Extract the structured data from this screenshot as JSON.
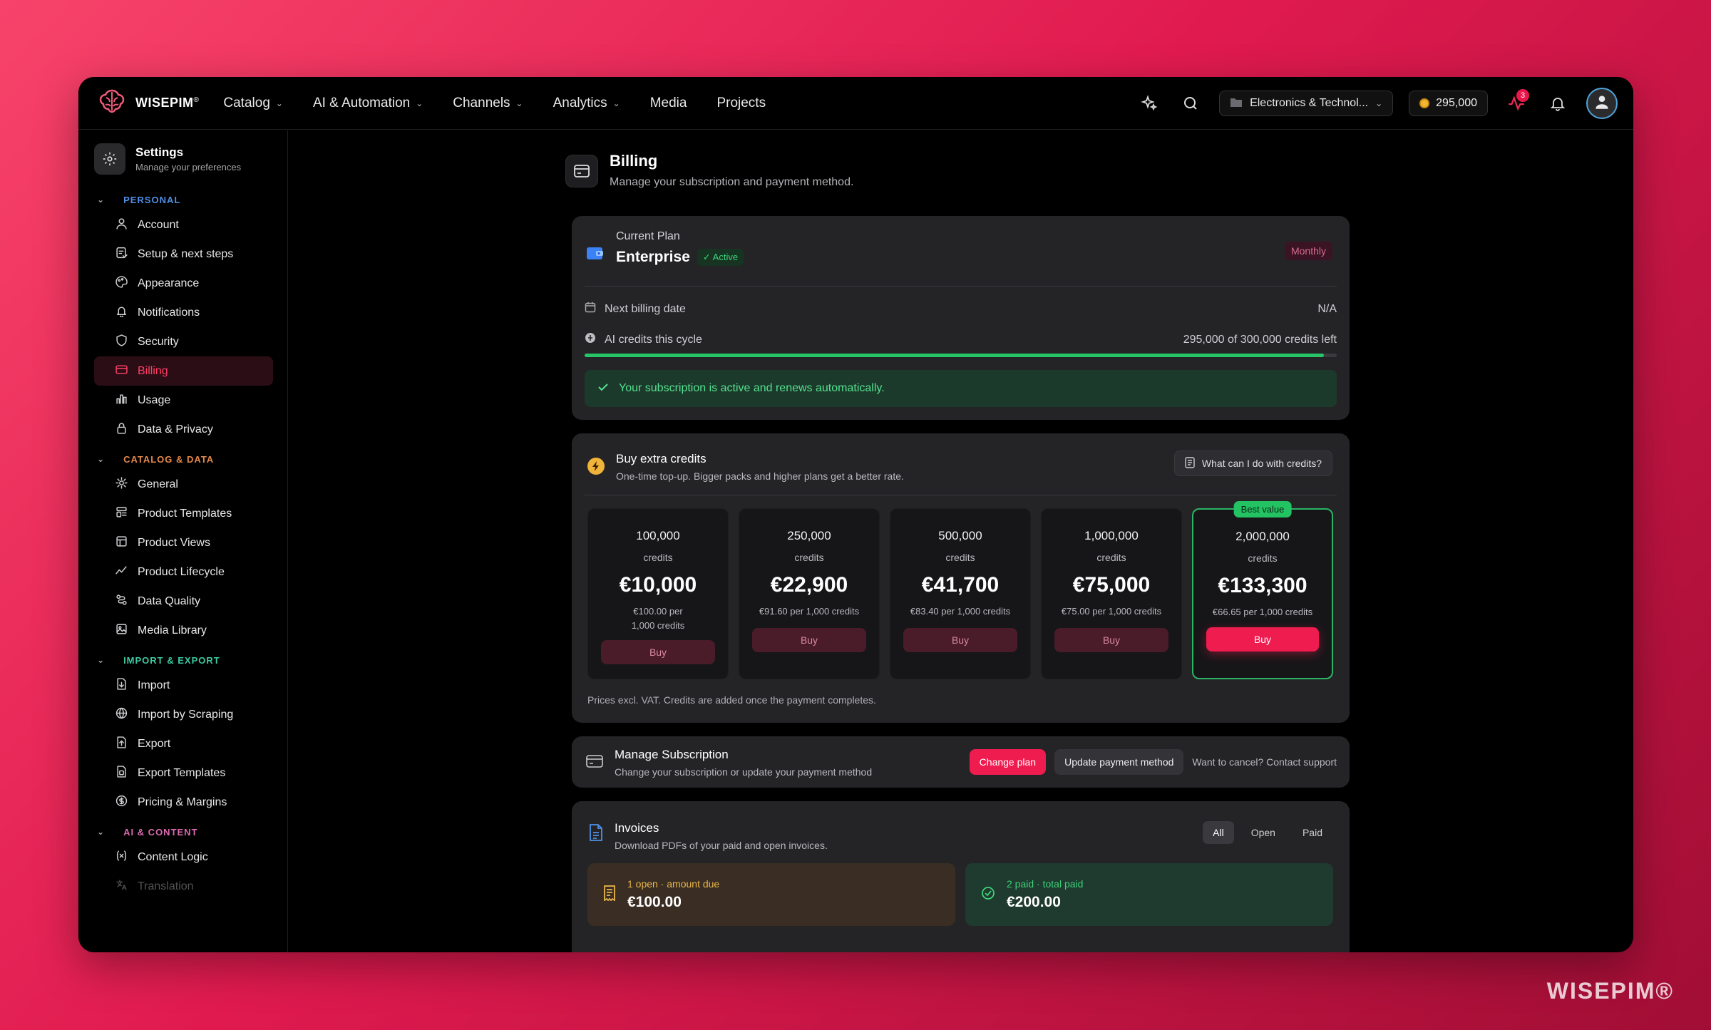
{
  "app": {
    "logo_text": "WISEPIM",
    "logo_mark": "®",
    "watermark": "WISEPIM®"
  },
  "topnav": {
    "items": [
      {
        "label": "Catalog",
        "has_dropdown": true
      },
      {
        "label": "AI & Automation",
        "has_dropdown": true
      },
      {
        "label": "Channels",
        "has_dropdown": true
      },
      {
        "label": "Analytics",
        "has_dropdown": true
      },
      {
        "label": "Media",
        "has_dropdown": false
      },
      {
        "label": "Projects",
        "has_dropdown": false
      }
    ],
    "workspace": "Electronics & Technol...",
    "credits": "295,000",
    "activity_badge": "3",
    "icons": [
      "sparkle-icon",
      "search-icon",
      "folder-icon",
      "coin-icon",
      "activity-icon",
      "bell-icon",
      "user-icon"
    ]
  },
  "sidebar": {
    "title": "Settings",
    "subtitle": "Manage your preferences",
    "sections": [
      {
        "label": "PERSONAL",
        "color": "#4f8fe6",
        "items": [
          "Account",
          "Setup & next steps",
          "Appearance",
          "Notifications",
          "Security",
          "Billing",
          "Usage",
          "Data & Privacy"
        ]
      },
      {
        "label": "CATALOG & DATA",
        "color": "#e6894a",
        "items": [
          "General",
          "Product Templates",
          "Product Views",
          "Product Lifecycle",
          "Data Quality",
          "Media Library"
        ]
      },
      {
        "label": "IMPORT & EXPORT",
        "color": "#3dc9a0",
        "items": [
          "Import",
          "Import by Scraping",
          "Export",
          "Export Templates",
          "Pricing & Margins"
        ]
      },
      {
        "label": "AI & CONTENT",
        "color": "#d96ab0",
        "items": [
          "Content Logic",
          "Translation"
        ]
      }
    ],
    "active_item": "Billing"
  },
  "page": {
    "title": "Billing",
    "subtitle": "Manage your subscription and payment method."
  },
  "plan": {
    "label": "Current Plan",
    "name": "Enterprise",
    "status": "Active",
    "cycle": "Monthly",
    "next_billing_label": "Next billing date",
    "next_billing_value": "N/A",
    "credits_label": "AI credits this cycle",
    "credits_value": "295,000 of 300,000 credits left",
    "credits_fraction": 0.983,
    "success_message": "Your subscription is active and renews automatically."
  },
  "buy": {
    "title": "Buy extra credits",
    "subtitle": "One-time top-up. Bigger packs and higher plans get a better rate.",
    "help_label": "What can I do with credits?",
    "footer": "Prices excl. VAT. Credits are added once the payment completes.",
    "best_badge": "Best value",
    "packs": [
      {
        "count": "100,000",
        "unit": "credits",
        "price": "€10,000",
        "rate": "€100.00 per 1,000 credits",
        "buy": "Buy",
        "best": false
      },
      {
        "count": "250,000",
        "unit": "credits",
        "price": "€22,900",
        "rate": "€91.60 per 1,000 credits",
        "buy": "Buy",
        "best": false
      },
      {
        "count": "500,000",
        "unit": "credits",
        "price": "€41,700",
        "rate": "€83.40 per 1,000 credits",
        "buy": "Buy",
        "best": false
      },
      {
        "count": "1,000,000",
        "unit": "credits",
        "price": "€75,000",
        "rate": "€75.00 per 1,000 credits",
        "buy": "Buy",
        "best": false
      },
      {
        "count": "2,000,000",
        "unit": "credits",
        "price": "€133,300",
        "rate": "€66.65 per 1,000 credits",
        "buy": "Buy",
        "best": true
      }
    ]
  },
  "manage": {
    "title": "Manage Subscription",
    "subtitle": "Change your subscription or update your payment method",
    "change_plan": "Change plan",
    "update_payment": "Update payment method",
    "cancel_text": "Want to cancel? Contact support"
  },
  "invoices": {
    "title": "Invoices",
    "subtitle": "Download PDFs of your paid and open invoices.",
    "tabs": [
      "All",
      "Open",
      "Paid"
    ],
    "active_tab": "All",
    "open_label": "1 open · amount due",
    "open_value": "€100.00",
    "paid_label": "2 paid · total paid",
    "paid_value": "€200.00"
  }
}
